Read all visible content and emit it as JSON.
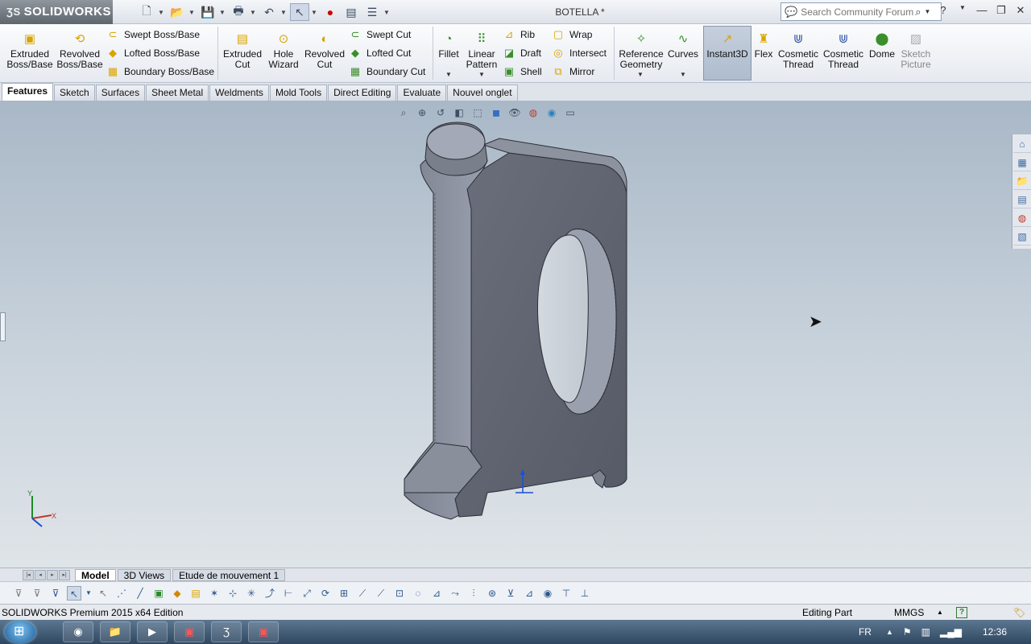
{
  "app": {
    "brand": "SOLIDWORKS",
    "document_title": "BOTELLA *",
    "search_placeholder": "Search Community Forum"
  },
  "ribbon": {
    "extruded_boss": "Extruded Boss/Base",
    "revolved_boss": "Revolved Boss/Base",
    "swept_boss": "Swept Boss/Base",
    "lofted_boss": "Lofted Boss/Base",
    "boundary_boss": "Boundary Boss/Base",
    "extruded_cut": "Extruded Cut",
    "hole_wizard": "Hole Wizard",
    "revolved_cut": "Revolved Cut",
    "swept_cut": "Swept Cut",
    "lofted_cut": "Lofted Cut",
    "boundary_cut": "Boundary Cut",
    "fillet": "Fillet",
    "linear_pattern": "Linear Pattern",
    "rib": "Rib",
    "draft": "Draft",
    "shell": "Shell",
    "wrap": "Wrap",
    "intersect": "Intersect",
    "mirror": "Mirror",
    "reference_geometry": "Reference Geometry",
    "curves": "Curves",
    "instant3d": "Instant3D",
    "flex": "Flex",
    "cosmetic_thread_1": "Cosmetic Thread",
    "cosmetic_thread_2": "Cosmetic Thread",
    "dome": "Dome",
    "sketch_picture": "Sketch Picture"
  },
  "tabs": [
    "Features",
    "Sketch",
    "Surfaces",
    "Sheet Metal",
    "Weldments",
    "Mold Tools",
    "Direct Editing",
    "Evaluate",
    "Nouvel onglet"
  ],
  "model_tabs": [
    "Model",
    "3D Views",
    "Etude de mouvement 1"
  ],
  "axes": {
    "x": "X",
    "y": "Y"
  },
  "status": {
    "edition": "SOLIDWORKS Premium 2015 x64 Edition",
    "mode": "Editing Part",
    "units": "MMGS"
  },
  "taskbar": {
    "lang": "FR",
    "time": "12:36"
  },
  "colors": {
    "part": "#5d616d",
    "viewport_top": "#a9b8c7",
    "viewport_bottom": "#dfe4e8"
  }
}
